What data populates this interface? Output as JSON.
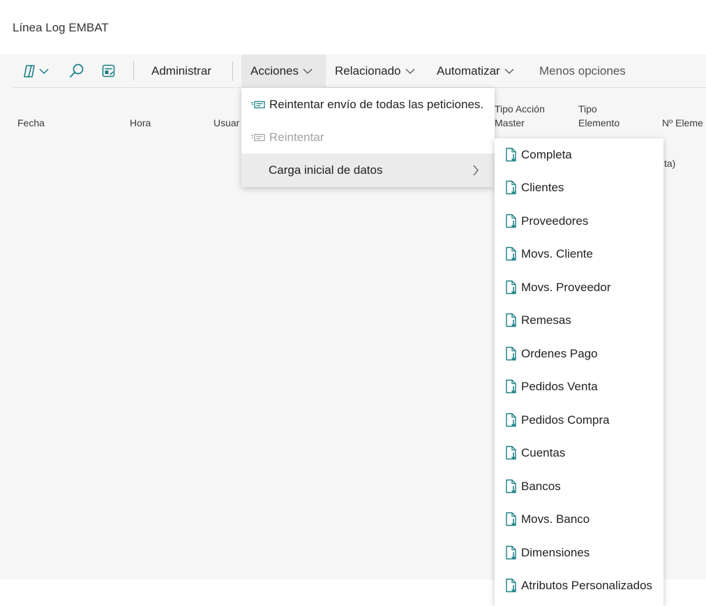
{
  "page": {
    "title": "Línea Log EMBAT"
  },
  "toolbar": {
    "icons": [
      "copilot-icon",
      "chevron-down-icon",
      "search-icon",
      "edit-list-icon"
    ],
    "buttons": [
      {
        "label": "Administrar"
      },
      {
        "label": "Acciones",
        "active": true
      },
      {
        "label": "Relacionado"
      },
      {
        "label": "Automatizar"
      },
      {
        "label": "Menos opciones"
      }
    ]
  },
  "table": {
    "columns": {
      "fecha": "Fecha",
      "hora": "Hora",
      "usuario": "Usuar",
      "tipo_accion_1": "Tipo Acción",
      "tipo_accion_2": "Master",
      "tipo_elemento_1": "Tipo",
      "tipo_elemento_2": "Elemento",
      "n_elemento": "Nº Eleme"
    },
    "peek_text": "ta)"
  },
  "actions_menu": {
    "items": [
      {
        "label": "Reintentar envío de todas las peticiones.",
        "icon": "retry-send-icon",
        "enabled": true
      },
      {
        "label": "Reintentar",
        "icon": "retry-send-icon",
        "enabled": false
      },
      {
        "label": "Carga inicial de datos",
        "icon": "chevron-right-icon",
        "has_submenu": true
      }
    ]
  },
  "submenu": {
    "icon": "document-import-icon",
    "items": [
      "Completa",
      "Clientes",
      "Proveedores",
      "Movs. Cliente",
      "Movs. Proveedor",
      "Remesas",
      "Ordenes Pago",
      "Pedidos Venta",
      "Pedidos Compra",
      "Cuentas",
      "Bancos",
      "Movs. Banco",
      "Dimensiones",
      "Atributos Personalizados"
    ]
  },
  "colors": {
    "accent": "#1a7f86",
    "workarea_bg": "#f6f6f6",
    "menu_highlight": "#ebebeb"
  }
}
